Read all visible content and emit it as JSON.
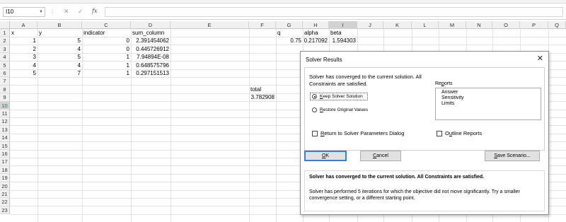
{
  "formula_bar": {
    "name_box": "I10",
    "cancel_glyph": "✕",
    "enter_glyph": "✓",
    "fx_label": "fx",
    "formula": ""
  },
  "columns": [
    "A",
    "B",
    "C",
    "D",
    "E",
    "F",
    "G",
    "H",
    "I",
    "J",
    "K",
    "L",
    "M",
    "N",
    "O",
    "P",
    "Q"
  ],
  "rows": [
    "1",
    "2",
    "3",
    "4",
    "5",
    "6",
    "7",
    "8",
    "9",
    "10",
    "11",
    "12",
    "13",
    "14",
    "15",
    "16",
    "17",
    "18",
    "19",
    "20",
    "21",
    "22",
    "23"
  ],
  "selected_cell": {
    "column": "I",
    "row": "10"
  },
  "sheet": {
    "headers": {
      "A": "x",
      "B": "y",
      "C": "indicator",
      "D": "sum_column",
      "G": "q",
      "H": "alpha",
      "I": "beta"
    },
    "data_rows": [
      {
        "x": "1",
        "y": "5",
        "indicator": "0",
        "sum_column": "2.391454062"
      },
      {
        "x": "2",
        "y": "4",
        "indicator": "0",
        "sum_column": "0.445726912"
      },
      {
        "x": "3",
        "y": "5",
        "indicator": "1",
        "sum_column": "7.94894E-08"
      },
      {
        "x": "4",
        "y": "4",
        "indicator": "1",
        "sum_column": "0.648575796"
      },
      {
        "x": "5",
        "y": "7",
        "indicator": "1",
        "sum_column": "0.297151513"
      }
    ],
    "params": {
      "q": "0.75",
      "alpha": "0.217092",
      "beta": "1.594303"
    },
    "total_label": "total",
    "total_value": "3.782908"
  },
  "dialog": {
    "title": "Solver Results",
    "close_glyph": "✕",
    "message": "Solver has converged to the current solution.  All Constraints are satisfied.",
    "keep_solution": {
      "accel": "K",
      "rest": "eep Solver Solution"
    },
    "restore_values": {
      "accel": "R",
      "rest": "estore Original Values"
    },
    "reports_label": {
      "pre": "Re",
      "accel": "p",
      "post": "orts"
    },
    "reports": [
      "Answer",
      "Sensitivity",
      "Limits"
    ],
    "return_to_dialog": {
      "accel": "R",
      "rest": "eturn to Solver Parameters Dialog"
    },
    "outline_reports": {
      "pre": "O",
      "accel": "u",
      "post": "tline Reports"
    },
    "ok_button": {
      "accel": "O",
      "rest": "K"
    },
    "cancel_button": {
      "accel": "C",
      "rest": "ancel"
    },
    "save_scenario_button": {
      "accel": "S",
      "rest": "ave Scenario..."
    },
    "status_title": "Solver has converged to the current solution.  All Constraints are satisfied.",
    "status_detail": "Solver has performed 5 iterations for which the objective did not move significantly. Try a smaller convergence setting, or a different starting point."
  }
}
